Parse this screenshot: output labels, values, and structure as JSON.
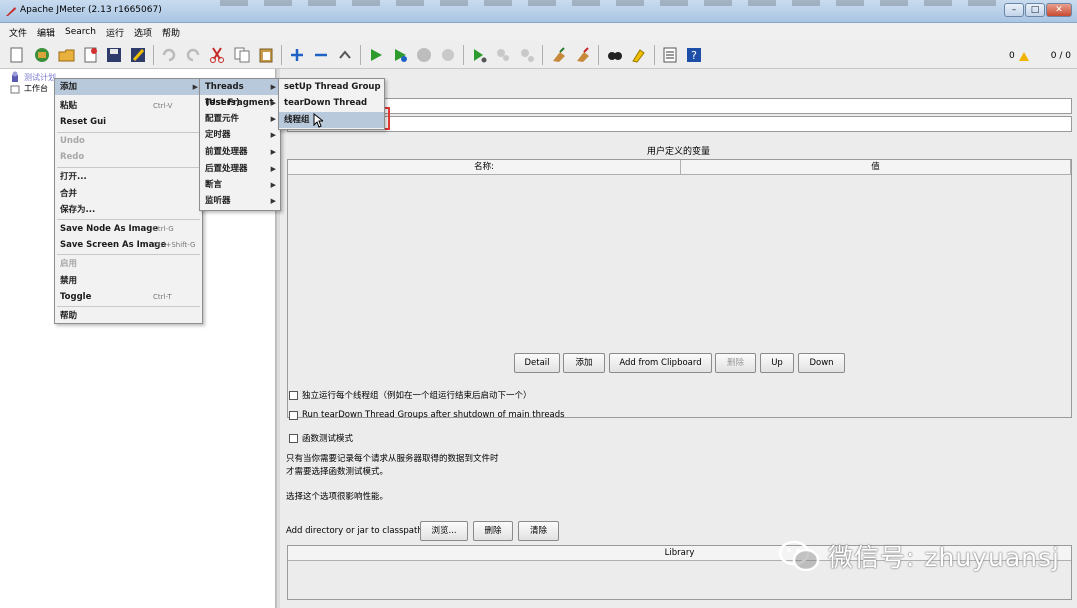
{
  "window": {
    "title": "Apache JMeter (2.13 r1665067)",
    "min": "–",
    "max": "□",
    "close": "✕"
  },
  "menubar": [
    "文件",
    "编辑",
    "Search",
    "运行",
    "选项",
    "帮助"
  ],
  "toolbar": {
    "status_warn": "0",
    "status_threads": "0 / 0"
  },
  "tree": {
    "root": "测试计划",
    "child": "工作台"
  },
  "panel": {
    "udv_title": "用户定义的变量",
    "col_name": "名称:",
    "col_value": "值",
    "buttons": [
      "Detail",
      "添加",
      "Add from Clipboard",
      "删除",
      "Up",
      "Down"
    ],
    "opt1": "独立运行每个线程组（例如在一个组运行结束后启动下一个）",
    "opt2": "Run tearDown Thread Groups after shutdown of main threads",
    "opt3": "函数测试模式",
    "note1": "只有当你需要记录每个请求从服务器取得的数据到文件时",
    "note2": "才需要选择函数测试模式。",
    "note3": "选择这个选项很影响性能。",
    "classpath_label": "Add directory or jar to classpath",
    "classpath_buttons": [
      "浏览...",
      "删除",
      "清除"
    ],
    "library_col": "Library"
  },
  "context_menu": [
    {
      "label": "添加"
    },
    {
      "label": "粘贴",
      "shortcut": "Ctrl-V"
    },
    {
      "label": "Reset Gui"
    },
    {
      "label": "Undo"
    },
    {
      "label": "Redo"
    },
    {
      "label": "打开..."
    },
    {
      "label": "合并"
    },
    {
      "label": "保存为..."
    },
    {
      "label": "Save Node As Image",
      "shortcut": "Ctrl-G"
    },
    {
      "label": "Save Screen As Image",
      "shortcut": "Ctrl+Shift-G"
    },
    {
      "label": "启用"
    },
    {
      "label": "禁用"
    },
    {
      "label": "Toggle",
      "shortcut": "Ctrl-T"
    },
    {
      "label": "帮助"
    }
  ],
  "add_submenu": [
    "Threads (Users)",
    "Test Fragment",
    "配置元件",
    "定时器",
    "前置处理器",
    "后置处理器",
    "断言",
    "监听器"
  ],
  "threads_submenu": [
    "setUp Thread Group",
    "tearDown Thread Group",
    "线程组"
  ],
  "watermark": "微信号: zhuyuansj"
}
